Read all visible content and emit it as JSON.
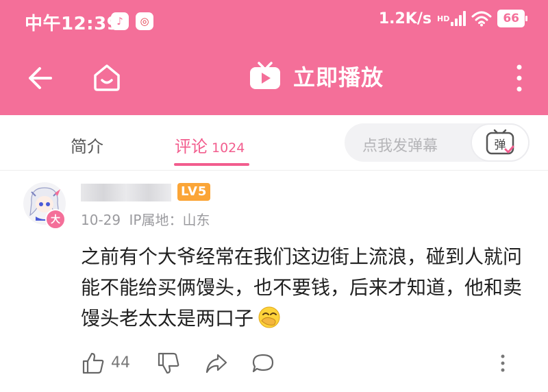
{
  "status_bar": {
    "time": "中午12:39",
    "network_speed": "1.2K/s",
    "network_type": "HD",
    "battery": "66"
  },
  "nav": {
    "play_label": "立即播放"
  },
  "tabs": {
    "intro_label": "简介",
    "comments_label": "评论",
    "comments_count": "1024",
    "danmaku_placeholder": "点我发弹幕",
    "danmaku_button_label": "弹"
  },
  "comment": {
    "avatar_badge": "大",
    "level_badge": "LV5",
    "date": "10-29",
    "ip_location": "IP属地：山东",
    "text": "之前有个大爷经常在我们这边街上流浪，碰到人就问能不能给买俩馒头，也不要钱，后来才知道，他和卖馒头老太太是两口子",
    "likes": "44"
  },
  "colors": {
    "brand_pink": "#f46f99",
    "accent_pink": "#f25d8e",
    "level_orange": "#fba537"
  }
}
